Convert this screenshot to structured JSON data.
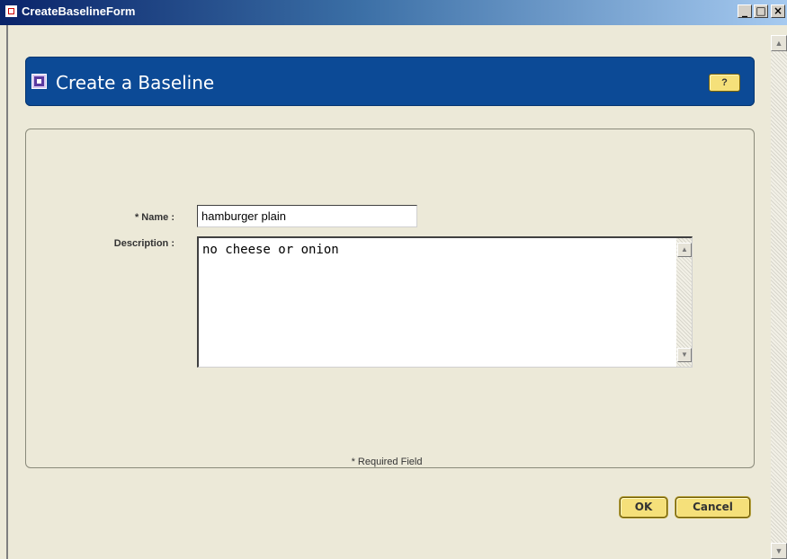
{
  "window": {
    "title": "CreateBaselineForm",
    "minimize_glyph": "_",
    "maximize_glyph": "□",
    "close_glyph": "×"
  },
  "banner": {
    "title": "Create a Baseline",
    "help_label": "?"
  },
  "form": {
    "name_label": "* Name :",
    "name_value": "hamburger plain",
    "description_label": "Description :",
    "description_value": "no cheese or onion",
    "required_note": "* Required Field"
  },
  "buttons": {
    "ok": "OK",
    "cancel": "Cancel"
  },
  "scroll_glyphs": {
    "up": "▲",
    "down": "▼"
  },
  "icons": [
    "window-app-icon",
    "form-icon",
    "help-icon",
    "scroll-up-icon",
    "scroll-down-icon"
  ]
}
